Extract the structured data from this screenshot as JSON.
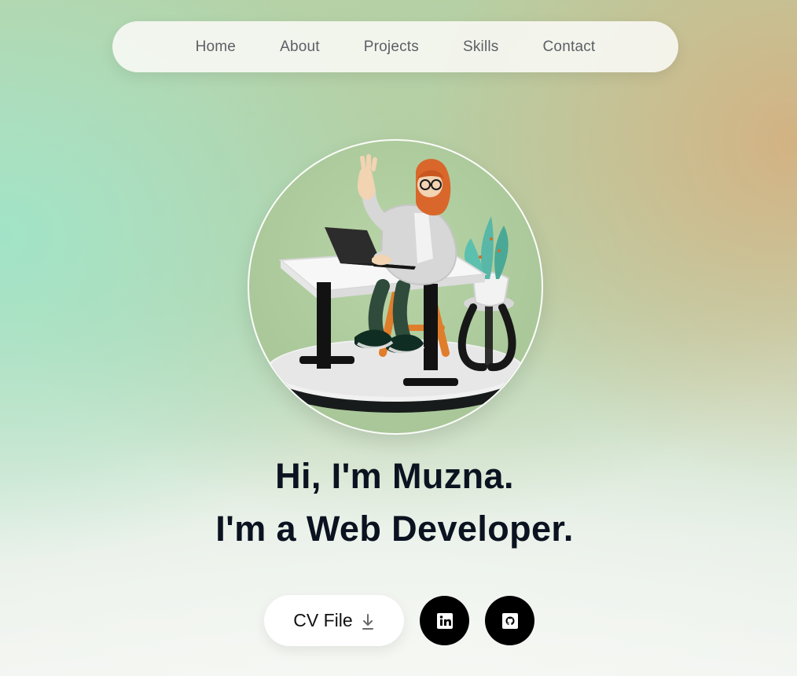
{
  "nav": {
    "items": [
      {
        "label": "Home"
      },
      {
        "label": "About"
      },
      {
        "label": "Projects"
      },
      {
        "label": "Skills"
      },
      {
        "label": "Contact"
      }
    ]
  },
  "hero": {
    "line1": "Hi, I'm Muzna.",
    "line2": "I'm a Web Developer."
  },
  "actions": {
    "cv_label": "CV File",
    "cv_icon": "download-icon",
    "socials": [
      {
        "icon": "linkedin-icon"
      },
      {
        "icon": "github-icon"
      }
    ]
  }
}
